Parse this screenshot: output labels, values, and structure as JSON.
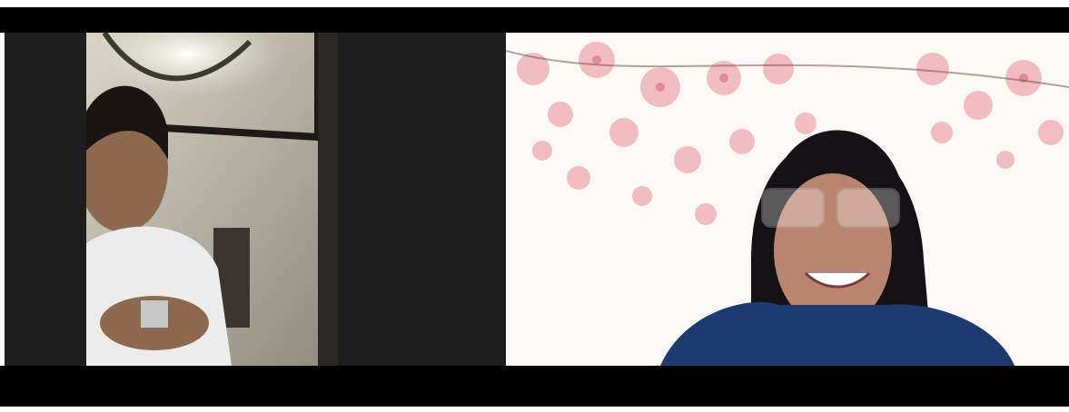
{
  "colors": {
    "letterbox": "#000000",
    "stage_background": "#1e1e1e",
    "tile_background": "#fbf8f7"
  }
}
